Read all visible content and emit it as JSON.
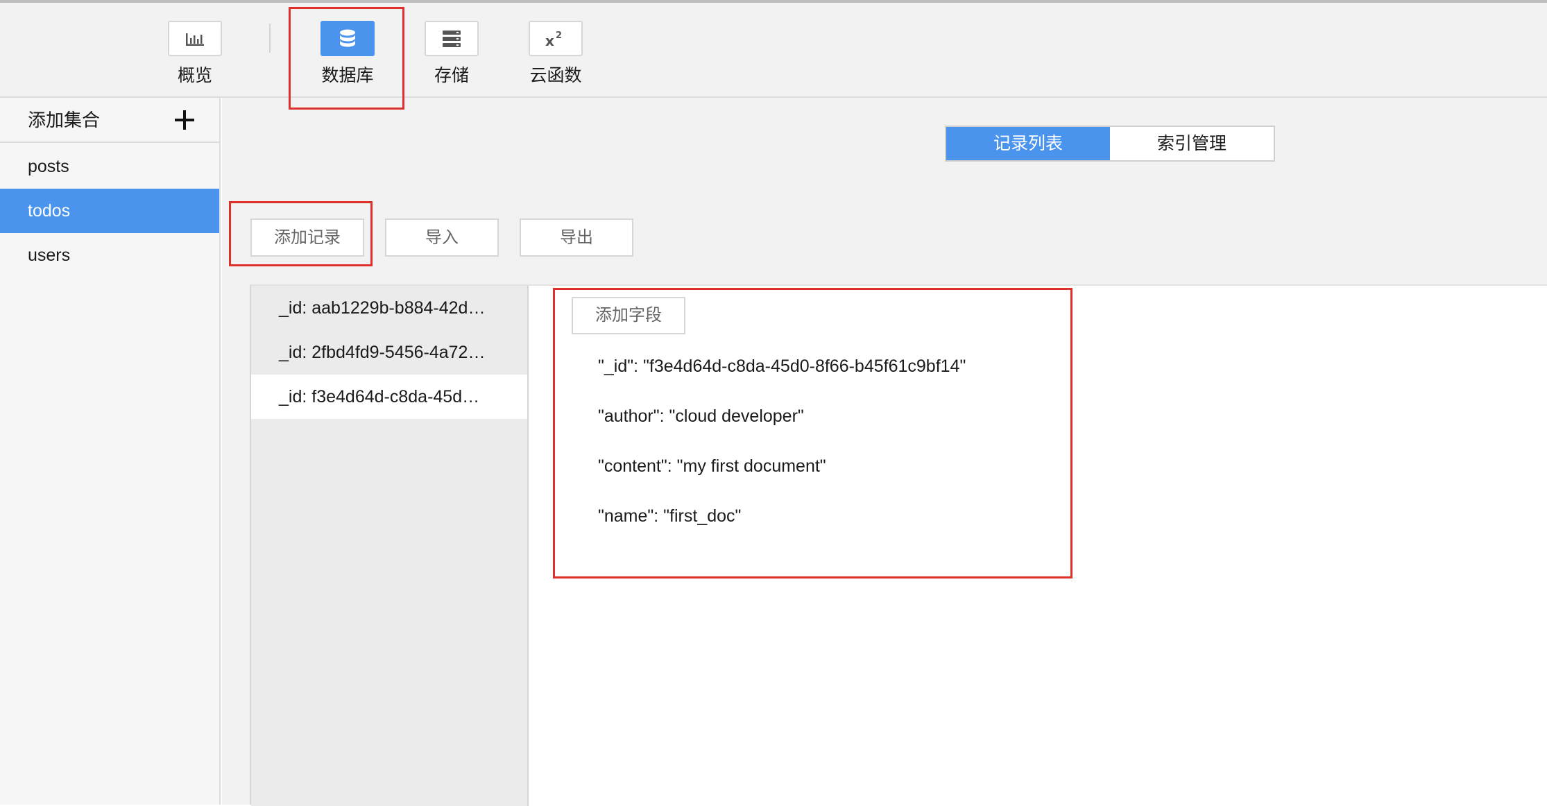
{
  "toolbar": {
    "items": [
      {
        "label": "概览",
        "icon": "bar-chart-icon"
      },
      {
        "label": "数据库",
        "icon": "database-icon"
      },
      {
        "label": "存储",
        "icon": "storage-icon"
      },
      {
        "label": "云函数",
        "icon": "function-x2-icon"
      }
    ],
    "active": "数据库"
  },
  "sidebar": {
    "header": "添加集合",
    "add_icon": "plus-icon",
    "collections": [
      {
        "label": "posts"
      },
      {
        "label": "todos"
      },
      {
        "label": "users"
      }
    ],
    "active": "todos"
  },
  "tabs": [
    {
      "label": "记录列表"
    },
    {
      "label": "索引管理"
    }
  ],
  "actions": {
    "add_record": "添加记录",
    "import": "导入",
    "export": "导出"
  },
  "records": [
    {
      "label": "_id: aab1229b-b884-42d…"
    },
    {
      "label": "_id: 2fbd4fd9-5456-4a72…"
    },
    {
      "label": "_id: f3e4d64d-c8da-45d…"
    }
  ],
  "selected_record": 3,
  "detail": {
    "add_field": "添加字段",
    "fields": [
      "\"_id\": \"f3e4d64d-c8da-45d0-8f66-b45f61c9bf14\"",
      "\"author\": \"cloud developer\"",
      "\"content\": \"my first document\"",
      "\"name\": \"first_doc\""
    ]
  },
  "colors": {
    "accent": "#4a94ee",
    "annotation": "#e0302c"
  }
}
